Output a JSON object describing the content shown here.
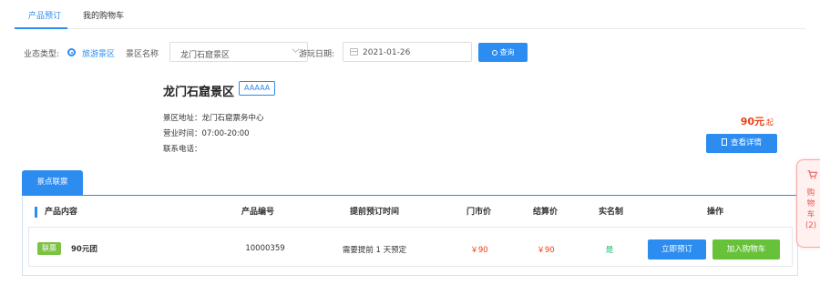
{
  "top_tabs": [
    {
      "label": "产品预订",
      "active": true
    },
    {
      "label": "我的购物车",
      "active": false
    }
  ],
  "filter": {
    "type_label": "业态类型:",
    "type_option": "旅游景区",
    "scenic_label": "景区名称",
    "scenic_value": "龙门石窟景区",
    "date_label": "游玩日期:",
    "date_value": "2021-01-26",
    "query_button": "查询"
  },
  "scenic": {
    "name": "龙门石窟景区",
    "rating": "AAAAA",
    "address": "景区地址：龙门石窟票务中心",
    "hours": "营业时间：07:00-20:00",
    "phone": "联系电话：",
    "price": "90元",
    "price_suffix": "起",
    "detail_button": "查看详情"
  },
  "product_tab": "景点联票",
  "table": {
    "headers": [
      "产品内容",
      "产品编号",
      "提前预订时间",
      "门市价",
      "结算价",
      "实名制",
      "操作"
    ],
    "rows": [
      {
        "badge": "联票",
        "name": "90元团",
        "code": "10000359",
        "advance": "需要提前 1 天预定",
        "market_price": "￥90",
        "settle_price": "￥90",
        "real_name": "是",
        "book_button": "立即预订",
        "cart_button": "加入购物车"
      }
    ]
  },
  "float_cart": {
    "chars": [
      "购",
      "物",
      "车"
    ],
    "count": "(2)"
  },
  "colors": {
    "primary": "#2d8cf0",
    "green": "#67c23a",
    "red": "#ed3f14"
  }
}
